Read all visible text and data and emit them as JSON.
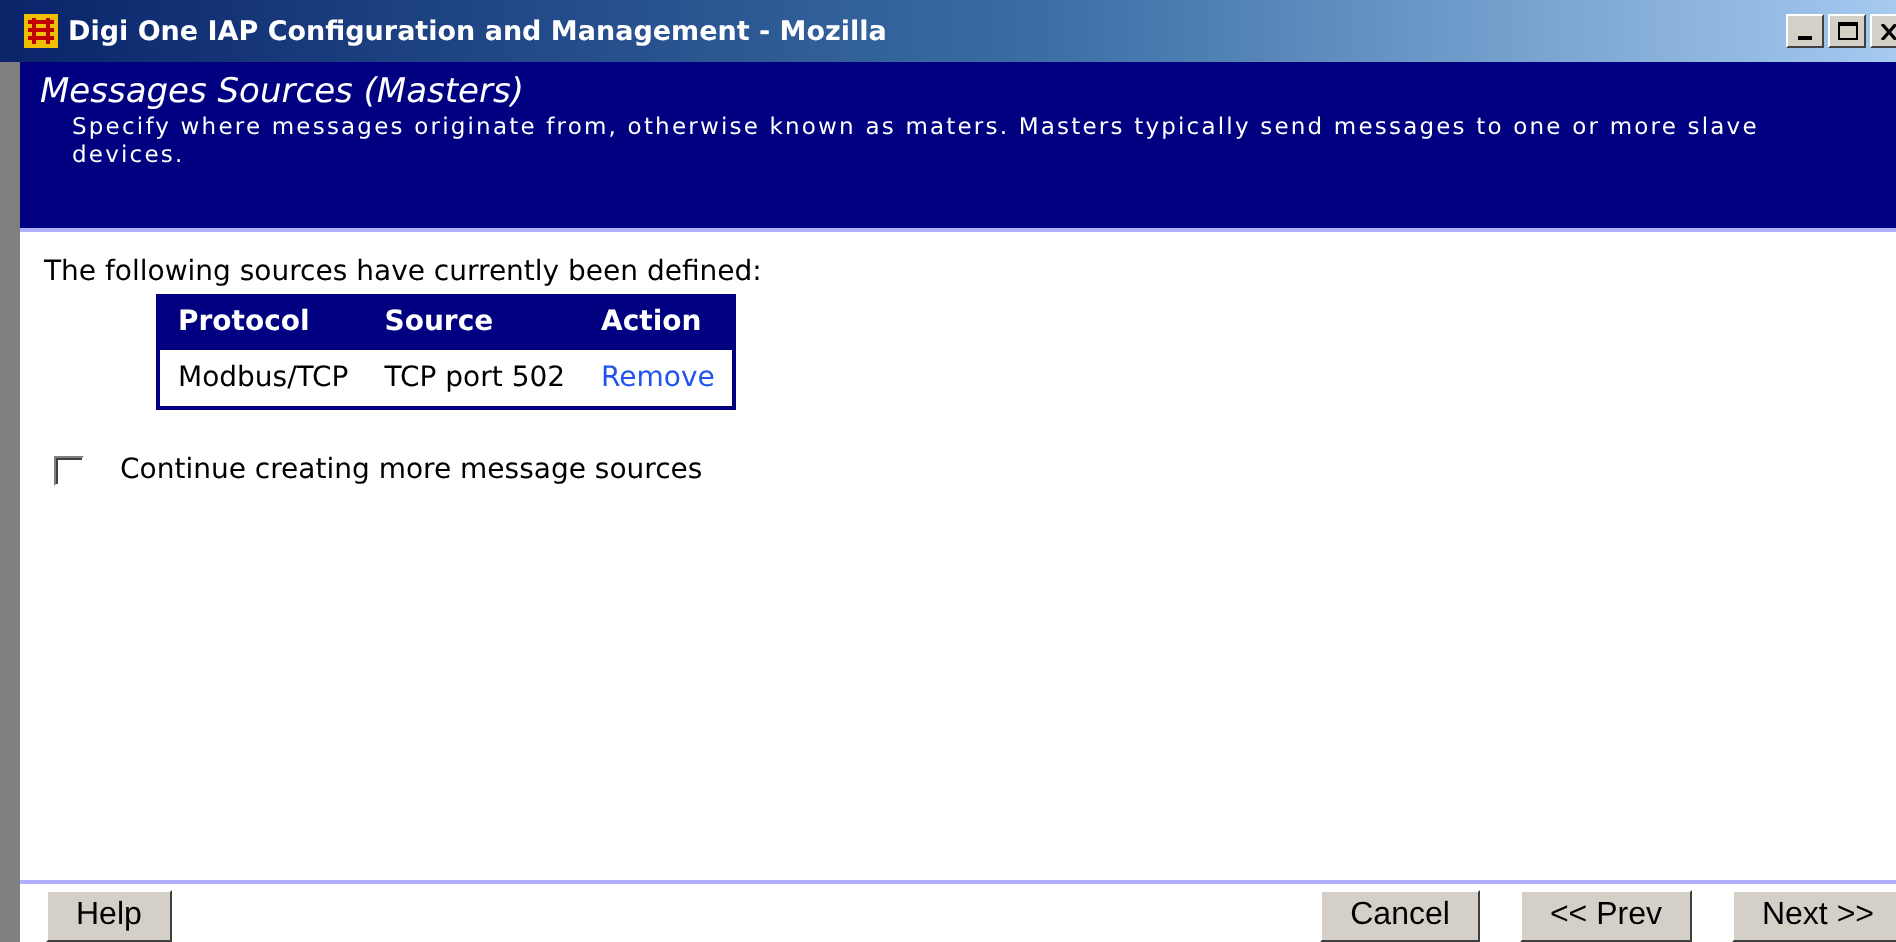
{
  "window": {
    "title": "Digi One IAP Configuration and Management - Mozilla"
  },
  "header": {
    "title": "Messages Sources (Masters)",
    "description": "Specify where messages originate from, otherwise known as maters. Masters typically send messages to one or more slave devices."
  },
  "intro": "The following sources have currently been defined:",
  "table": {
    "columns": [
      "Protocol",
      "Source",
      "Action"
    ],
    "rows": [
      {
        "protocol": "Modbus/TCP",
        "source": "TCP port 502",
        "action": "Remove"
      }
    ]
  },
  "continue_option": {
    "label": "Continue creating more message sources",
    "checked": false
  },
  "buttons": {
    "help": "Help",
    "cancel": "Cancel",
    "prev": "<< Prev",
    "next": "Next >>"
  }
}
